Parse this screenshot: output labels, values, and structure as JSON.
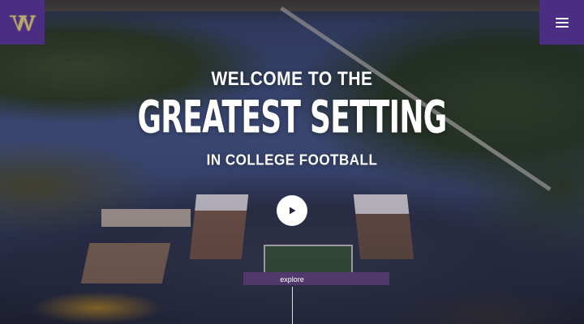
{
  "branding": {
    "logo_letter": "W",
    "brand_color": "#4b2e83",
    "logo_color": "#b7a57a"
  },
  "menu": {
    "icon": "hamburger-menu-icon"
  },
  "hero": {
    "line1": "WELCOME TO THE",
    "line2": "GREATEST SETTING",
    "line3": "IN COLLEGE FOOTBALL",
    "play_icon": "play-icon",
    "explore_label": "explore"
  }
}
